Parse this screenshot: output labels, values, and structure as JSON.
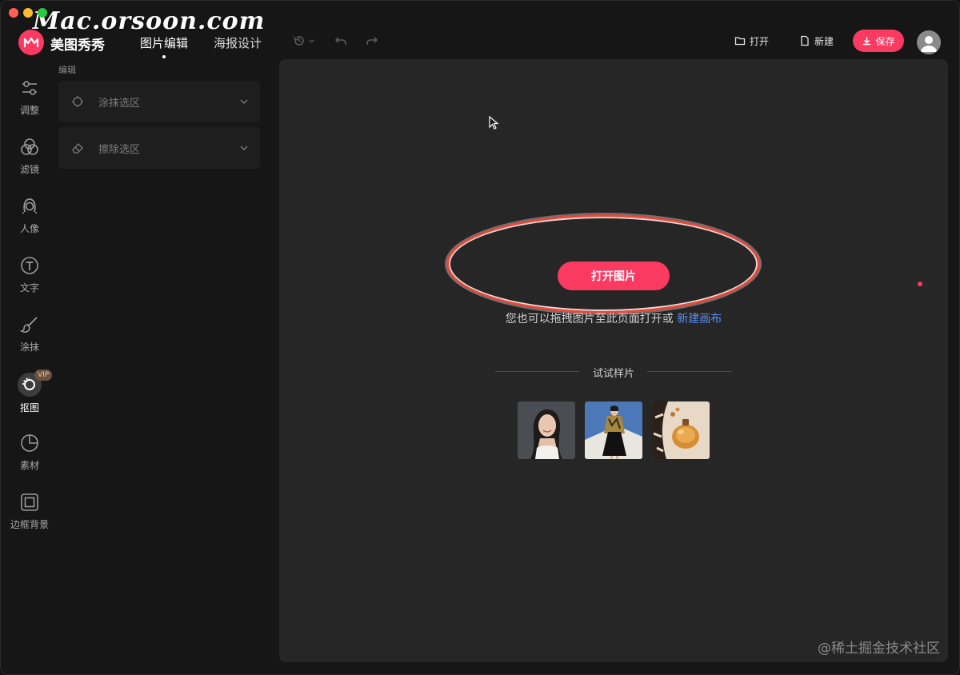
{
  "watermark": "Mac.orsoon.com",
  "header": {
    "brand": "美图秀秀",
    "tabs": [
      {
        "label": "图片编辑",
        "active": true
      },
      {
        "label": "海报设计",
        "active": false
      }
    ],
    "open_label": "打开",
    "new_label": "新建",
    "save_label": "保存"
  },
  "sidebar": {
    "items": [
      {
        "label": "调整",
        "icon": "sliders-icon"
      },
      {
        "label": "滤镜",
        "icon": "filter-circles-icon"
      },
      {
        "label": "人像",
        "icon": "portrait-icon"
      },
      {
        "label": "文字",
        "icon": "text-t-icon"
      },
      {
        "label": "涂抹",
        "icon": "brush-icon"
      },
      {
        "label": "抠图",
        "icon": "cutout-icon",
        "active": true,
        "badge": "VIP"
      },
      {
        "label": "素材",
        "icon": "sticker-icon"
      },
      {
        "label": "边框背景",
        "icon": "frame-icon"
      }
    ]
  },
  "panel": {
    "title": "编辑",
    "items": [
      {
        "label": "涂抹选区",
        "icon": "brush-select-icon"
      },
      {
        "label": "擦除选区",
        "icon": "eraser-icon"
      }
    ]
  },
  "canvas": {
    "open_button": "打开图片",
    "hint_text": "您也可以拖拽图片至此页面打开或",
    "hint_link": "新建画布",
    "samples_title": "试试样片"
  },
  "footer_watermark": "@稀土掘金技术社区",
  "colors": {
    "accent": "#fb3a62",
    "link": "#5b8cf0",
    "canvas_bg": "#262626",
    "window_bg": "#161616"
  }
}
